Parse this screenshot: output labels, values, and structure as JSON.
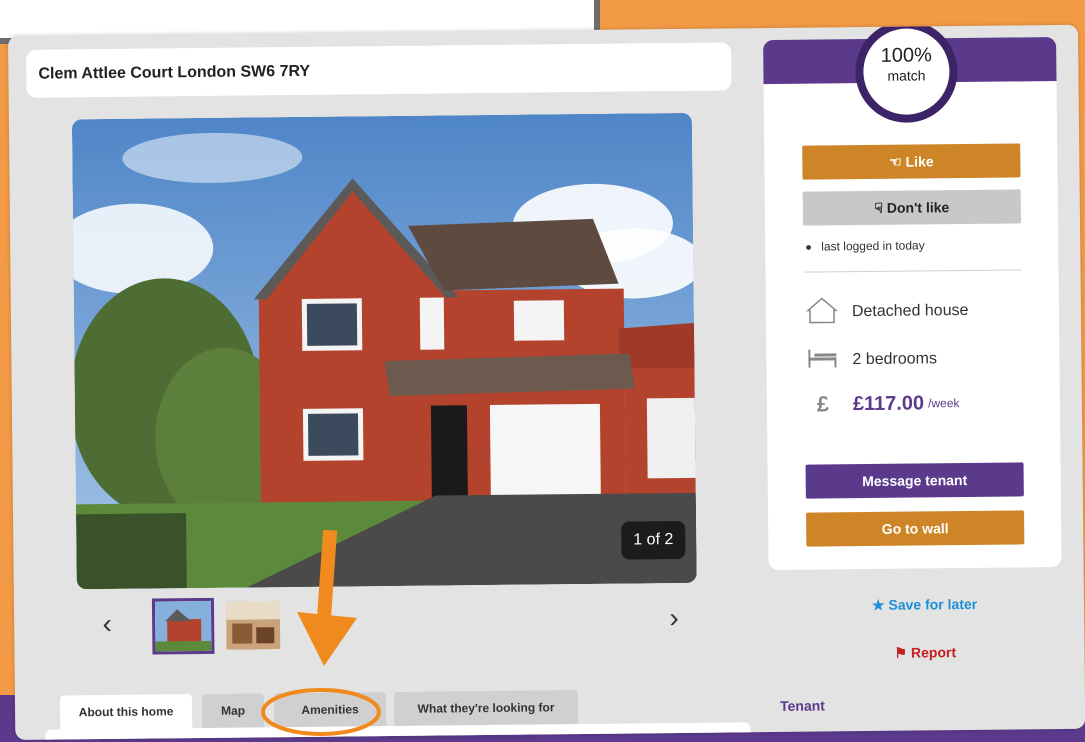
{
  "listing": {
    "address": "Clem Attlee Court London SW6 7RY"
  },
  "gallery": {
    "counter": "1 of 2",
    "prev_icon": "chevron-left-icon",
    "next_icon": "chevron-right-icon",
    "prev_glyph": "‹",
    "next_glyph": "›"
  },
  "tabs": [
    {
      "label": "About this home"
    },
    {
      "label": "Map"
    },
    {
      "label": "Amenities"
    },
    {
      "label": "What they're looking for"
    }
  ],
  "sidebar": {
    "match_percent": "100%",
    "match_label": "match",
    "like_label": "Like",
    "dislike_label": "Don't like",
    "last_logged": "last logged in today",
    "property_type": "Detached house",
    "bedrooms": "2 bedrooms",
    "price": "£117.00",
    "price_unit": "/week",
    "message_label": "Message tenant",
    "wall_label": "Go to wall",
    "save_label": "Save for later",
    "report_label": "Report",
    "tenant_heading": "Tenant"
  },
  "colors": {
    "accent_purple": "#5b3a8c",
    "accent_orange": "#cd8527",
    "link_blue": "#1e90d6",
    "report_red": "#c62020",
    "annotation_orange": "#f0891e"
  }
}
